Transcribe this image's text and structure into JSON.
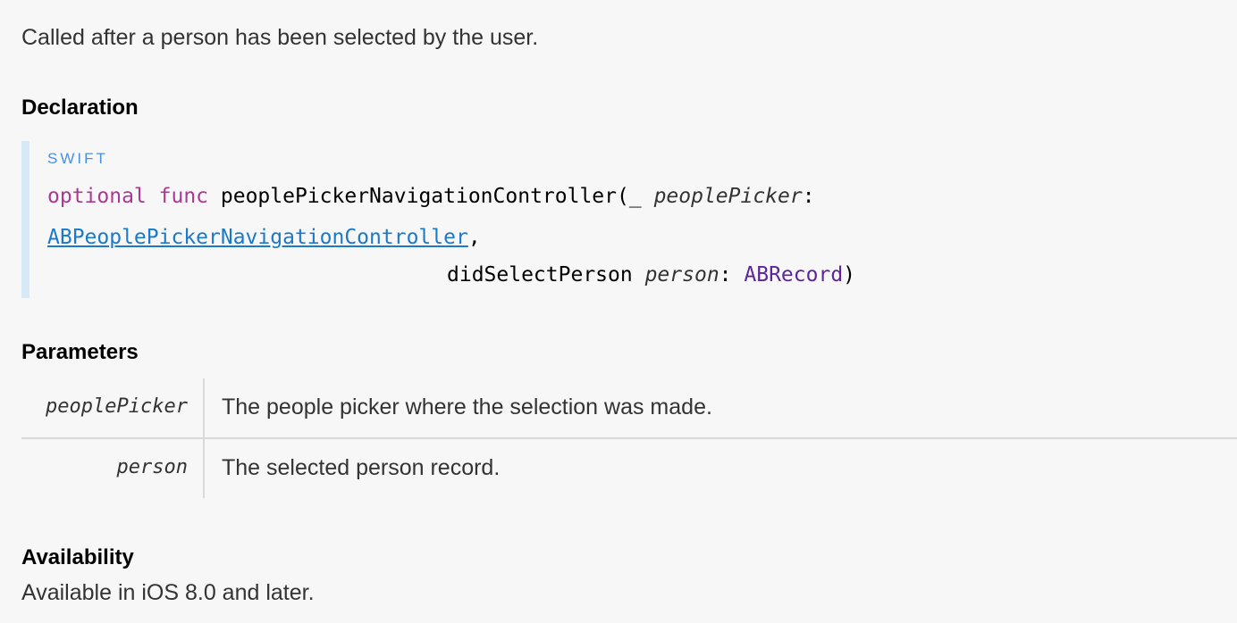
{
  "abstract": "Called after a person has been selected by the user.",
  "declaration": {
    "heading": "Declaration",
    "language": "SWIFT",
    "code": {
      "kw_optional": "optional",
      "kw_func": "func",
      "method_name": "peoplePickerNavigationController(",
      "underscore": "_ ",
      "param1_name": "peoplePicker",
      "colon": ":",
      "param1_type": "ABPeoplePickerNavigationController",
      "comma": ",",
      "label2": "didSelectPerson",
      "param2_name": "person",
      "param2_type": "ABRecord",
      "close_paren": ")"
    }
  },
  "parameters": {
    "heading": "Parameters",
    "rows": [
      {
        "name": "peoplePicker",
        "description": "The people picker where the selection was made."
      },
      {
        "name": "person",
        "description": "The selected person record."
      }
    ]
  },
  "availability": {
    "heading": "Availability",
    "text": "Available in iOS 8.0 and later."
  },
  "colors": {
    "keyword": "#a93a91",
    "link": "#1b79c9",
    "type": "#5c2699",
    "language_label": "#4a90e2",
    "code_border": "#d6e9f5"
  }
}
